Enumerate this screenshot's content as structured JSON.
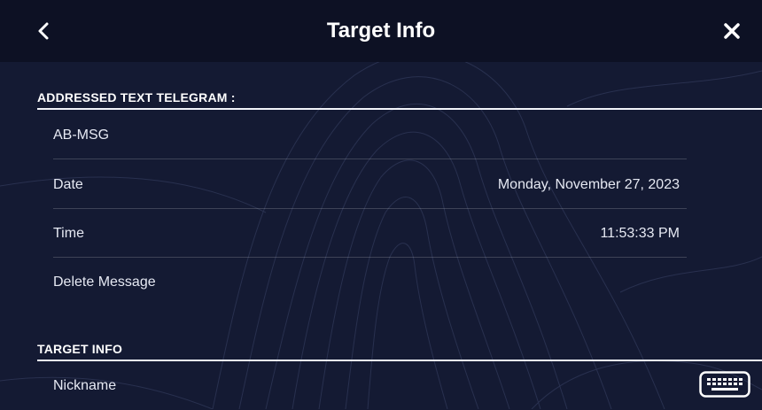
{
  "header": {
    "title": "Target Info",
    "back_icon": "chevron-left-icon",
    "close_icon": "close-icon"
  },
  "telegram_section": {
    "header": "ADDRESSED TEXT TELEGRAM :",
    "message_label": "AB-MSG",
    "date_label": "Date",
    "date_value": "Monday, November 27, 2023",
    "time_label": "Time",
    "time_value": "11:53:33 PM",
    "delete_label": "Delete Message"
  },
  "target_section": {
    "header": "TARGET INFO",
    "nickname_label": "Nickname",
    "keyboard_icon": "keyboard-icon"
  },
  "colors": {
    "background": "#141a33",
    "titlebar": "#0d1124",
    "text": "#e6e9f3"
  }
}
